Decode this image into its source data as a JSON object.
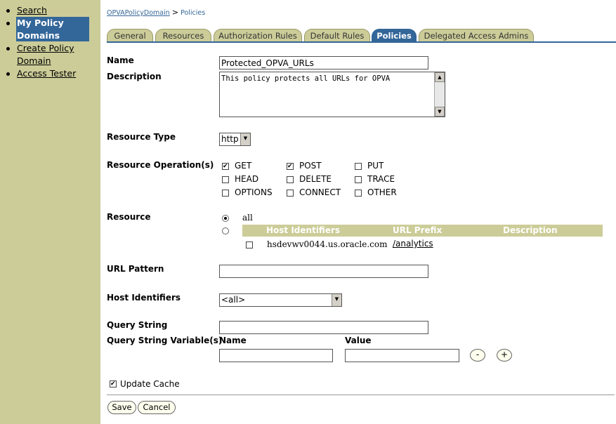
{
  "sidebar": {
    "items": [
      {
        "label": "Search"
      },
      {
        "label_line1": "My Policy",
        "label_line2": "Domains"
      },
      {
        "label_line1": "Create Policy",
        "label_line2": "Domain"
      },
      {
        "label": "Access Tester"
      }
    ]
  },
  "breadcrumb": {
    "domain": "OPVAPolicyDomain",
    "separator": ">",
    "current": "Policies"
  },
  "tabs": [
    "General",
    "Resources",
    "Authorization Rules",
    "Default Rules",
    "Policies",
    "Delegated Access Admins"
  ],
  "form": {
    "name_label": "Name",
    "name_value": "Protected_OPVA_URLs",
    "description_label": "Description",
    "description_value": "This policy protects all URLs for OPVA",
    "resource_type_label": "Resource Type",
    "resource_type_value": "http",
    "resource_ops_label": "Resource Operation(s)",
    "ops": {
      "get": "GET",
      "post": "POST",
      "put": "PUT",
      "head": "HEAD",
      "delete": "DELETE",
      "trace": "TRACE",
      "options": "OPTIONS",
      "connect": "CONNECT",
      "other": "OTHER"
    },
    "resource_label": "Resource",
    "resource_all": "all",
    "resource_table": {
      "headers": [
        "Host Identifiers",
        "URL Prefix",
        "Description"
      ],
      "row": {
        "host": "hsdevwv0044.us.oracle.com",
        "url_prefix": "/analytics",
        "description": ""
      }
    },
    "url_pattern_label": "URL Pattern",
    "url_pattern_value": "",
    "host_identifiers_label": "Host Identifiers",
    "host_identifiers_value": "<all>",
    "query_string_label": "Query String",
    "query_string_value": "",
    "qsv_label": "Query String Variable(s)",
    "qsv_name_header": "Name",
    "qsv_value_header": "Value",
    "minus": "-",
    "plus": "+",
    "update_cache_label": "Update Cache"
  },
  "buttons": {
    "save": "Save",
    "cancel": "Cancel"
  },
  "colors": {
    "sidebar": "#cccc99",
    "accent": "#336699",
    "tab_inactive": "#cccc99"
  }
}
